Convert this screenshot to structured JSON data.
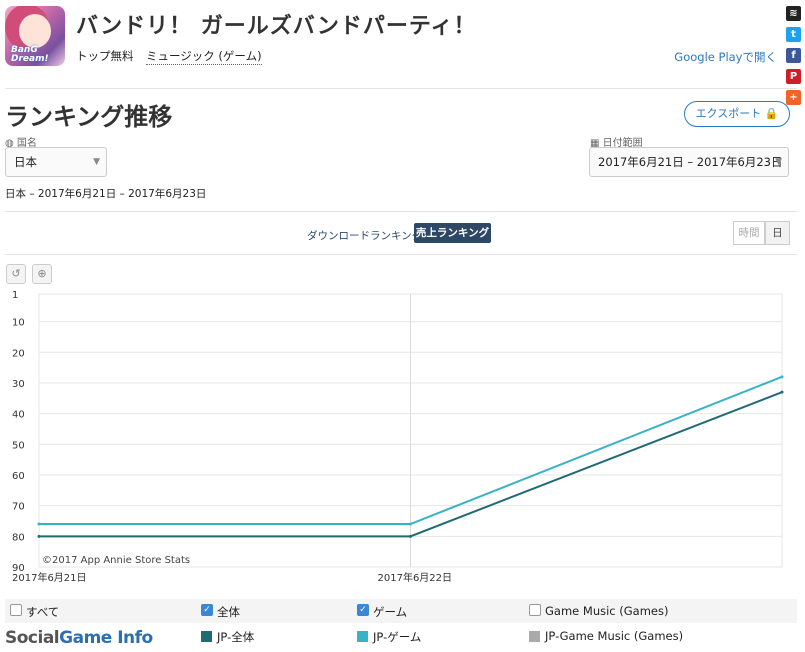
{
  "app": {
    "title": "バンドリ！ ガールズバンドパーティ！",
    "category_rank": "トップ無料",
    "genre": "ミュージック (ゲーム)",
    "store_link": "Google Playで開く",
    "icon_text": "BanG Dream!"
  },
  "share": [
    {
      "icon": "buffer-icon",
      "color": "#222222",
      "glyph": "≋"
    },
    {
      "icon": "twitter-icon",
      "color": "#1da1f2",
      "glyph": "t"
    },
    {
      "icon": "facebook-icon",
      "color": "#3b5998",
      "glyph": "f"
    },
    {
      "icon": "pinterest-icon",
      "color": "#cb2027",
      "glyph": "P"
    },
    {
      "icon": "plus-icon",
      "color": "#f0642a",
      "glyph": "+"
    }
  ],
  "page": {
    "title": "ランキング推移",
    "export_label": "エクスポート 🔒",
    "country_label": "国名",
    "country_value": "日本",
    "date_label": "日付範囲",
    "date_value": "2017年6月21日 – 2017年6月23日",
    "summary": "日本 – 2017年6月21日 – 2017年6月23日"
  },
  "tabs": {
    "downloads": "ダウンロードランキング",
    "revenue": "売上ランキング",
    "hourly": "時間",
    "daily": "日"
  },
  "toolbar": {
    "reset_glyph": "↺",
    "zoom_glyph": "⊕"
  },
  "colors": {
    "overall": "#1f6b73",
    "game": "#36b3c5",
    "game_music": "#aaaaaa",
    "accent": "#2b79c2"
  },
  "chart_data": {
    "type": "line",
    "x": [
      "2017-06-21",
      "2017-06-22",
      "2017-06-23"
    ],
    "x_tick_labels": [
      "2017年6月21日",
      "2017年6月22日"
    ],
    "y_ticks": [
      1,
      10,
      20,
      30,
      40,
      50,
      60,
      70,
      80,
      90
    ],
    "ylim": [
      1,
      90
    ],
    "y_inverted": true,
    "grid": true,
    "series": [
      {
        "name": "JP-全体",
        "color": "#1f6b73",
        "values": [
          80,
          80,
          33
        ]
      },
      {
        "name": "JP-ゲーム",
        "color": "#36b3c5",
        "values": [
          76,
          76,
          28
        ]
      }
    ],
    "credit": "©2017 App Annie Store Stats"
  },
  "legend": {
    "checks": [
      {
        "label": "すべて",
        "checked": false
      },
      {
        "label": "全体",
        "checked": true
      },
      {
        "label": "ゲーム",
        "checked": true
      },
      {
        "label": "Game Music (Games)",
        "checked": false
      }
    ],
    "series": [
      {
        "label": "JP-全体",
        "color": "#1f6b73"
      },
      {
        "label": "JP-ゲーム",
        "color": "#36b3c5"
      },
      {
        "label": "JP-Game Music (Games)",
        "color": "#aaaaaa"
      }
    ]
  },
  "watermark": {
    "part1": "Social",
    "part2": "Game Info"
  }
}
